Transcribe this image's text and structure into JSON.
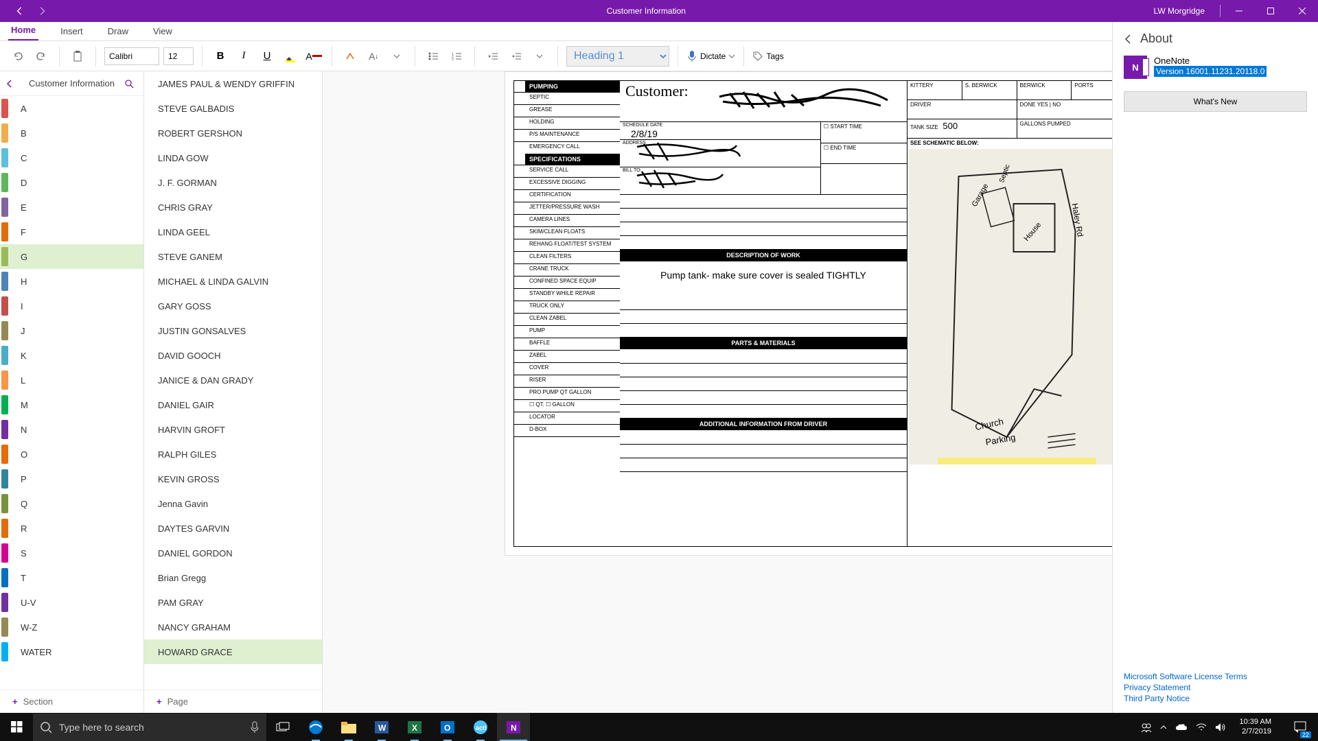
{
  "titlebar": {
    "title": "Customer Information",
    "user": "LW Morgridge"
  },
  "tabs": {
    "home": "Home",
    "insert": "Insert",
    "draw": "Draw",
    "view": "View"
  },
  "ribbon": {
    "font": "Calibri",
    "size": "12",
    "style": "Heading 1",
    "dictate": "Dictate",
    "tags": "Tags"
  },
  "nav": {
    "notebook": "Customer Information",
    "add_section": "Section",
    "add_page": "Page",
    "sections": [
      {
        "label": "A",
        "color": "#D9534F"
      },
      {
        "label": "B",
        "color": "#F0AD4E"
      },
      {
        "label": "C",
        "color": "#5BC0DE"
      },
      {
        "label": "D",
        "color": "#5CB85C"
      },
      {
        "label": "E",
        "color": "#8064A2"
      },
      {
        "label": "F",
        "color": "#E26B0A"
      },
      {
        "label": "G",
        "color": "#9BBB59",
        "selected": true
      },
      {
        "label": "H",
        "color": "#4F81BD"
      },
      {
        "label": "I",
        "color": "#C0504D"
      },
      {
        "label": "J",
        "color": "#948A54"
      },
      {
        "label": "K",
        "color": "#4BACC6"
      },
      {
        "label": "L",
        "color": "#F79646"
      },
      {
        "label": "M",
        "color": "#00B050"
      },
      {
        "label": "N",
        "color": "#7030A0"
      },
      {
        "label": "O",
        "color": "#E46C0A"
      },
      {
        "label": "P",
        "color": "#31859C"
      },
      {
        "label": "Q",
        "color": "#76933C"
      },
      {
        "label": "R",
        "color": "#E26B0A"
      },
      {
        "label": "S",
        "color": "#D60093"
      },
      {
        "label": "T",
        "color": "#0070C0"
      },
      {
        "label": "U-V",
        "color": "#7030A0"
      },
      {
        "label": "W-Z",
        "color": "#948A54"
      },
      {
        "label": "WATER",
        "color": "#00B0F0"
      }
    ],
    "pages": [
      "JAMES PAUL & WENDY GRIFFIN",
      "STEVE GALBADIS",
      "ROBERT GERSHON",
      "LINDA GOW",
      "J. F. GORMAN",
      "CHRIS GRAY",
      "LINDA GEEL",
      "STEVE GANEM",
      "MICHAEL & LINDA GALVIN",
      " GARY GOSS",
      "JUSTIN GONSALVES",
      "DAVID GOOCH",
      "JANICE & DAN GRADY",
      "DANIEL GAIR",
      "HARVIN GROFT",
      "RALPH GILES",
      "KEVIN GROSS",
      "Jenna Gavin",
      "DAYTES GARVIN",
      "DANIEL GORDON",
      "Brian Gregg",
      "PAM  GRAY",
      "NANCY GRAHAM",
      "HOWARD GRACE"
    ],
    "selected_page": 23
  },
  "form": {
    "header_pumping": "PUMPING",
    "header_specs": "SPECIFICATIONS",
    "customer_label": "Customer:",
    "schedule_label": "SCHEDULE DATE",
    "schedule_date": "2/8/19",
    "address_label": "ADDRESS",
    "billto_label": "BILL TO:",
    "start_time": "START TIME",
    "end_time": "END TIME",
    "kittery": "KITTERY",
    "sberwick": "S. BERWICK",
    "berwick": "BERWICK",
    "ports": "PORTS",
    "driver": "DRIVER",
    "done": "DONE   YES  |  NO",
    "tank_size_label": "TANK SIZE",
    "tank_size": "500",
    "gallons_pumped": "GALLONS PUMPED",
    "schematic": "SEE SCHEMATIC BELOW:",
    "desc_header": "DESCRIPTION OF WORK",
    "desc_body": "Pump tank- make sure cover is sealed TIGHTLY",
    "parts_header": "PARTS & MATERIALS",
    "addl_header": "ADDITIONAL INFORMATION FROM DRIVER",
    "left_cells": [
      "SEPTIC",
      "GREASE",
      "HOLDING",
      "P/S MAINTENANCE",
      "EMERGENCY CALL"
    ],
    "left_cells2": [
      "SERVICE CALL",
      "EXCESSIVE DIGGING",
      "CERTIFICATION",
      "JETTER/PRESSURE WASH",
      "CAMERA LINES",
      "SKIM/CLEAN FLOATS",
      "REHANG FLOAT/TEST SYSTEM",
      "CLEAN FILTERS",
      "CRANE TRUCK",
      "CONFINED SPACE EQUIP",
      "STANDBY WHILE REPAIR",
      "TRUCK ONLY",
      "CLEAN ZABEL",
      "PUMP",
      "BAFFLE",
      "ZABEL",
      "COVER",
      "RISER",
      "PRO PUMP QT GALLON",
      "☐ QT.   ☐  GALLON",
      "LOCATOR",
      "D-BOX",
      ""
    ]
  },
  "about": {
    "title": "About",
    "app": "OneNote",
    "version": "Version 16001.11231.20118.0",
    "whats_new": "What's New",
    "link1": "Microsoft Software License Terms",
    "link2": "Privacy Statement",
    "link3": "Third Party Notice"
  },
  "taskbar": {
    "search_placeholder": "Type here to search",
    "time": "10:39 AM",
    "date": "2/7/2019",
    "notif_count": "22"
  }
}
